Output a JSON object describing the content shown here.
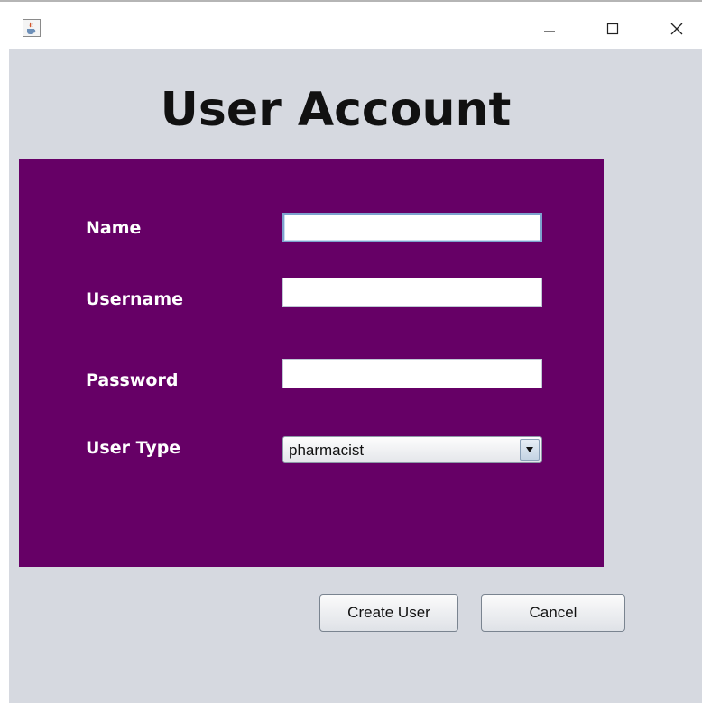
{
  "window": {
    "minimize_glyph": "—",
    "maximize_glyph": "☐",
    "close_glyph": "✕",
    "app_icon": "java-cup-icon"
  },
  "heading": "User Account",
  "form": {
    "name_label": "Name",
    "name_value": "",
    "username_label": "Username",
    "username_value": "",
    "password_label": "Password",
    "password_value": "",
    "user_type_label": "User Type",
    "user_type_selected": "pharmacist"
  },
  "buttons": {
    "create_label": "Create User",
    "cancel_label": "Cancel"
  },
  "colors": {
    "panel": "#660066",
    "content_bg": "#d6d9e0"
  }
}
